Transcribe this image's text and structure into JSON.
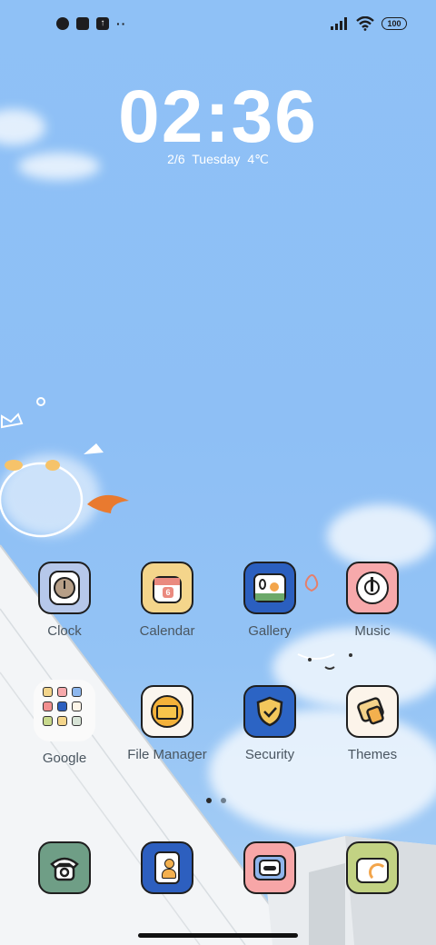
{
  "status_bar": {
    "left_icons": [
      "notification-face-icon",
      "notification-square-icon",
      "notification-upload-icon"
    ],
    "more_dots": "··",
    "battery": "100",
    "right_icons": [
      "signal-icon",
      "wifi-icon",
      "battery-icon"
    ]
  },
  "clock_widget": {
    "time": "02:36",
    "date": "2/6",
    "weekday": "Tuesday",
    "temperature": "4℃"
  },
  "apps": [
    {
      "label": "Clock",
      "icon": "clock-icon",
      "bg": "#b6c8ea"
    },
    {
      "label": "Calendar",
      "icon": "calendar-icon",
      "bg": "#f4d58b",
      "badge": "6"
    },
    {
      "label": "Gallery",
      "icon": "gallery-icon",
      "bg": "#2b5fbf"
    },
    {
      "label": "Music",
      "icon": "music-icon",
      "bg": "#f7a9ab"
    },
    {
      "label": "Google",
      "icon": "google-folder-icon",
      "bg": "#fafafa"
    },
    {
      "label": "File Manager",
      "icon": "folder-icon",
      "bg": "#fbf6ef"
    },
    {
      "label": "Security",
      "icon": "shield-icon",
      "bg": "#2c64c4"
    },
    {
      "label": "Themes",
      "icon": "themes-icon",
      "bg": "#fcf4ea"
    }
  ],
  "dock": [
    {
      "icon": "phone-icon",
      "bg": "#6f9e86"
    },
    {
      "icon": "contacts-icon",
      "bg": "#2d5fbf"
    },
    {
      "icon": "messages-icon",
      "bg": "#f7a6a7"
    },
    {
      "icon": "camera-icon",
      "bg": "#c2d283"
    }
  ],
  "page_indicator": {
    "pages": 2,
    "current": 1
  }
}
